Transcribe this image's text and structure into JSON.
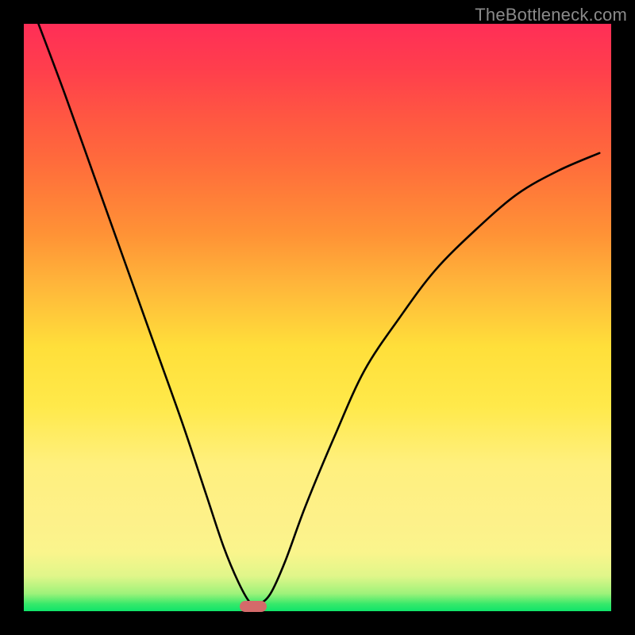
{
  "watermark": {
    "text": "TheBottleneck.com"
  },
  "chart_data": {
    "type": "line",
    "title": "",
    "xlabel": "",
    "ylabel": "",
    "xlim": [
      0,
      1
    ],
    "ylim": [
      0,
      1
    ],
    "grid": false,
    "legend": false,
    "background": {
      "kind": "vertical-gradient",
      "stops": [
        {
          "pos": 0.0,
          "color": "#10e46a"
        },
        {
          "pos": 0.1,
          "color": "#faf58c"
        },
        {
          "pos": 0.45,
          "color": "#ffdf3a"
        },
        {
          "pos": 0.7,
          "color": "#ff8038"
        },
        {
          "pos": 1.0,
          "color": "#ff2e57"
        }
      ]
    },
    "vertex": {
      "x": 0.39,
      "y": 0.005
    },
    "marker": {
      "x": 0.39,
      "y": 0.005,
      "shape": "rounded-bar",
      "color": "#d46a6a"
    },
    "notes": "Single V-shaped curve. x/y are normalized 0–1 to the plot area. Curve starts near top-left, dips to near-zero at x≈0.39, rises toward upper-right (ending around y≈0.78).",
    "series": [
      {
        "name": "curve",
        "color": "#000000",
        "x": [
          0.025,
          0.07,
          0.12,
          0.17,
          0.22,
          0.27,
          0.31,
          0.34,
          0.365,
          0.385,
          0.4,
          0.42,
          0.445,
          0.48,
          0.53,
          0.58,
          0.64,
          0.7,
          0.77,
          0.84,
          0.91,
          0.98
        ],
        "y": [
          1.0,
          0.88,
          0.74,
          0.6,
          0.46,
          0.32,
          0.2,
          0.11,
          0.05,
          0.015,
          0.012,
          0.03,
          0.085,
          0.18,
          0.3,
          0.41,
          0.5,
          0.58,
          0.65,
          0.71,
          0.75,
          0.78
        ]
      }
    ]
  }
}
